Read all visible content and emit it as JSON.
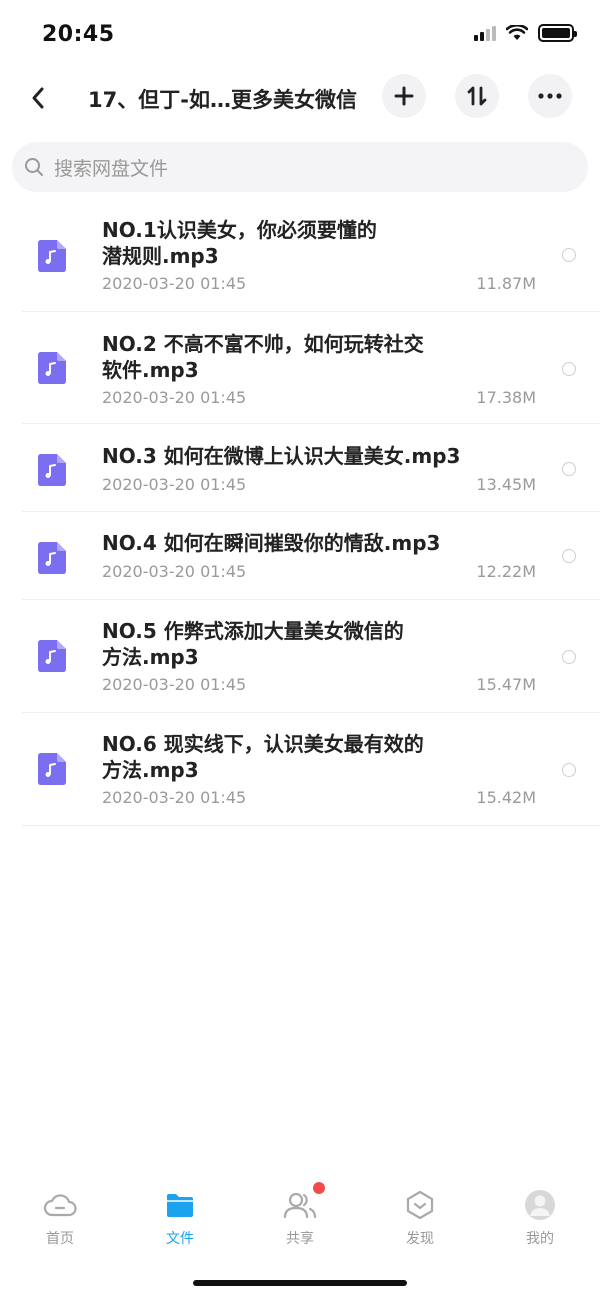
{
  "status_bar": {
    "time": "20:45"
  },
  "nav": {
    "title": "17、但丁-如…更多美女微信"
  },
  "search": {
    "placeholder": "搜索网盘文件"
  },
  "colors": {
    "accent": "#1ba3f0",
    "music_icon": "#7b6ef0",
    "badge": "#f24b4b"
  },
  "files": [
    {
      "name_line1": "NO.1认识美女，你必须要懂的",
      "name_line2": "潜规则.mp3",
      "date": "2020-03-20 01:45",
      "size": "11.87M",
      "icon": "music-file-icon"
    },
    {
      "name_line1": "NO.2 不高不富不帅，如何玩转社交",
      "name_line2": "软件.mp3",
      "date": "2020-03-20 01:45",
      "size": "17.38M",
      "icon": "music-file-icon"
    },
    {
      "name_line1": "NO.3 如何在微博上认识大量美女.mp3",
      "name_line2": "",
      "date": "2020-03-20 01:45",
      "size": "13.45M",
      "icon": "music-file-icon"
    },
    {
      "name_line1": "NO.4 如何在瞬间摧毁你的情敌.mp3",
      "name_line2": "",
      "date": "2020-03-20 01:45",
      "size": "12.22M",
      "icon": "music-file-icon"
    },
    {
      "name_line1": "NO.5 作弊式添加大量美女微信的",
      "name_line2": "方法.mp3",
      "date": "2020-03-20 01:45",
      "size": "15.47M",
      "icon": "music-file-icon"
    },
    {
      "name_line1": "NO.6 现实线下，认识美女最有效的",
      "name_line2": "方法.mp3",
      "date": "2020-03-20 01:45",
      "size": "15.42M",
      "icon": "music-file-icon"
    }
  ],
  "tabs": [
    {
      "label": "首页",
      "icon": "cloud-icon"
    },
    {
      "label": "文件",
      "icon": "folder-icon",
      "active": true
    },
    {
      "label": "共享",
      "icon": "people-icon"
    },
    {
      "label": "发现",
      "icon": "discover-icon"
    },
    {
      "label": "我的",
      "icon": "avatar-icon"
    }
  ]
}
